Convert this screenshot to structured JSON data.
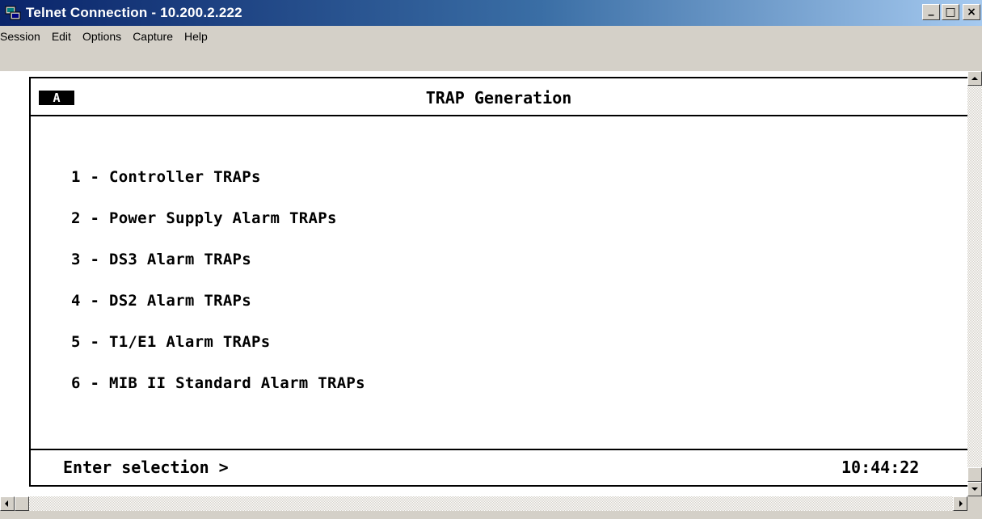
{
  "window": {
    "title": "Telnet Connection - 10.200.2.222",
    "controls": {
      "minimize": "_",
      "maximize": "□",
      "close": "×"
    }
  },
  "menu": [
    "Session",
    "Edit",
    "Options",
    "Capture",
    "Help"
  ],
  "terminal": {
    "session_badge": "A",
    "screen_title": "TRAP Generation",
    "options": [
      "1 - Controller TRAPs",
      "2 - Power Supply Alarm TRAPs",
      "3 - DS3 Alarm TRAPs",
      "4 - DS2 Alarm TRAPs",
      "5 - T1/E1 Alarm TRAPs",
      "6 - MIB II Standard Alarm TRAPs"
    ],
    "prompt": "Enter selection >",
    "clock": "10:44:22"
  },
  "icons": {
    "app": "telnet-app-icon",
    "scroll_up": "arrow-up-icon",
    "scroll_down": "arrow-down-icon",
    "scroll_left": "arrow-left-icon",
    "scroll_right": "arrow-right-icon"
  },
  "colors": {
    "titlebar_start": "#0a246a",
    "titlebar_end": "#a6caf0",
    "chrome": "#d4d0c8",
    "terminal_bg": "#ffffff",
    "terminal_fg": "#000000"
  }
}
